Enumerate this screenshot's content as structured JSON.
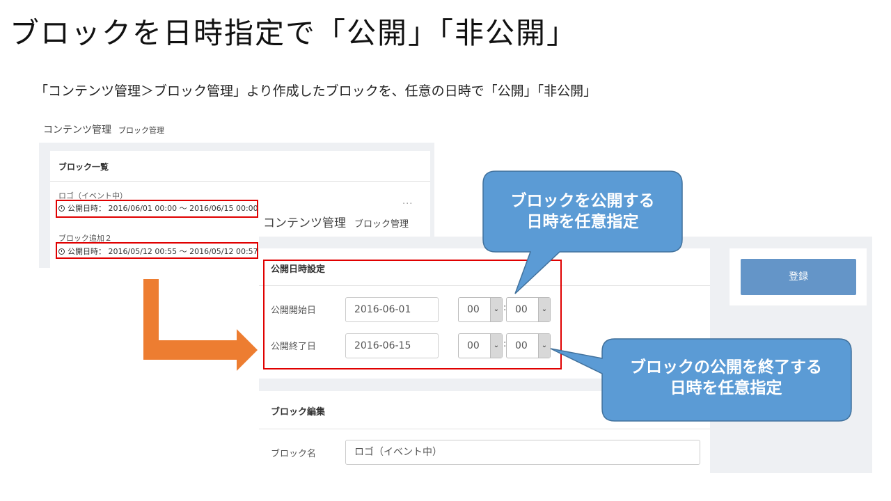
{
  "title": "ブロックを日時指定で「公開」「非公開」",
  "subtitle": "「コンテンツ管理＞ブロック管理」より作成したブロックを、任意の日時で「公開」「非公開」",
  "back_screen": {
    "breadcrumb_main": "コンテンツ管理",
    "breadcrumb_sub": "ブロック管理",
    "list_title": "ブロック一覧",
    "more_label": "...",
    "items": [
      {
        "name": "ロゴ（イベント中）",
        "date": "公開日時： 2016/06/01 00:00 〜 2016/06/15 00:00"
      },
      {
        "name": "ブロック追加２",
        "date": "公開日時： 2016/05/12 00:55 〜 2016/05/12 00:57"
      }
    ]
  },
  "front_screen": {
    "breadcrumb_main": "コンテンツ管理",
    "breadcrumb_sub": "ブロック管理",
    "publish_section_title": "公開日時設定",
    "start_label": "公開開始日",
    "start_date": "2016-06-01",
    "start_hour": "00",
    "start_minute": "00",
    "end_label": "公開終了日",
    "end_date": "2016-06-15",
    "end_hour": "00",
    "end_minute": "00",
    "time_separator": ":",
    "register_button": "登録",
    "edit_section_title": "ブロック編集",
    "block_name_label": "ブロック名",
    "block_name_value": "ロゴ（イベント中）"
  },
  "callouts": {
    "publish_line1": "ブロックを公開する",
    "publish_line2": "日時を任意指定",
    "end_line1": "ブロックの公開を終了する",
    "end_line2": "日時を任意指定"
  },
  "colors": {
    "callout": "#5b9bd5",
    "arrow": "#ed7d31",
    "highlight": "#e00000",
    "register_button": "#6495c8"
  }
}
